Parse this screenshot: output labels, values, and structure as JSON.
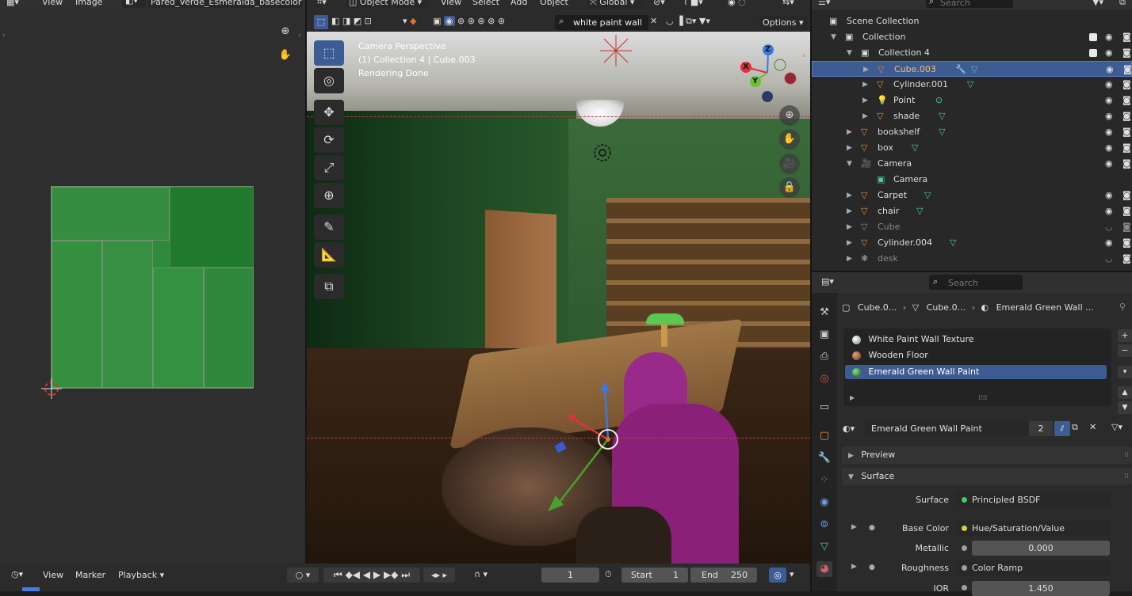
{
  "image_editor": {
    "menus": [
      "View",
      "Image"
    ],
    "image_name": "Pared_Verde_Esmeralda_basecolor",
    "zoom_icon": "zoom-in-icon",
    "pan_icon": "hand-icon"
  },
  "viewport": {
    "mode": "Object Mode",
    "menus": [
      "View",
      "Select",
      "Add",
      "Object"
    ],
    "transform_orientation": "Global",
    "search_value": "white paint wall",
    "options_label": "Options",
    "overlay_lines": [
      "Camera Perspective",
      "(1) Collection 4 | Cube.003",
      "Rendering Done"
    ],
    "axes": {
      "x": "X",
      "y": "Y",
      "z": "Z"
    }
  },
  "outliner": {
    "search_placeholder": "Search",
    "rows": [
      {
        "label": "Scene Collection"
      },
      {
        "label": "Collection"
      },
      {
        "label": "Collection 4"
      },
      {
        "label": "Cube.003"
      },
      {
        "label": "Cylinder.001"
      },
      {
        "label": "Point"
      },
      {
        "label": "shade"
      },
      {
        "label": "bookshelf"
      },
      {
        "label": "box"
      },
      {
        "label": "Camera"
      },
      {
        "label": "Camera"
      },
      {
        "label": "Carpet"
      },
      {
        "label": "chair"
      },
      {
        "label": "Cube"
      },
      {
        "label": "Cylinder.004"
      },
      {
        "label": "desk"
      }
    ]
  },
  "properties": {
    "search_placeholder": "Search",
    "breadcrumb": [
      "Cube.0...",
      "Cube.0...",
      "Emerald Green Wall ..."
    ],
    "material_slots": [
      "White Paint Wall Texture",
      "Wooden Floor",
      "Emerald Green Wall Paint"
    ],
    "material_name": "Emerald Green Wall Paint",
    "user_count": "2",
    "panels": {
      "preview": "Preview",
      "surface": "Surface"
    },
    "fields": [
      {
        "label": "Surface",
        "value": "Principled BSDF",
        "dot": "#3fcf5f"
      },
      {
        "label": "Base Color",
        "value": "Hue/Saturation/Value",
        "dot": "#d8d040"
      },
      {
        "label": "Metallic",
        "value": "0.000",
        "dot": "#a0a0a0"
      },
      {
        "label": "Roughness",
        "value": "Color Ramp",
        "dot": "#a0a0a0"
      },
      {
        "label": "IOR",
        "value": "1.450",
        "dot": "#a0a0a0"
      }
    ]
  },
  "timeline": {
    "menus": [
      "View",
      "Marker",
      "Playback"
    ],
    "current_frame": "1",
    "start_label": "Start",
    "start_value": "1",
    "end_label": "End",
    "end_value": "250"
  },
  "colors": {
    "accent": "#3e5c94",
    "header": "#303030",
    "panel": "#2b2b2b"
  }
}
